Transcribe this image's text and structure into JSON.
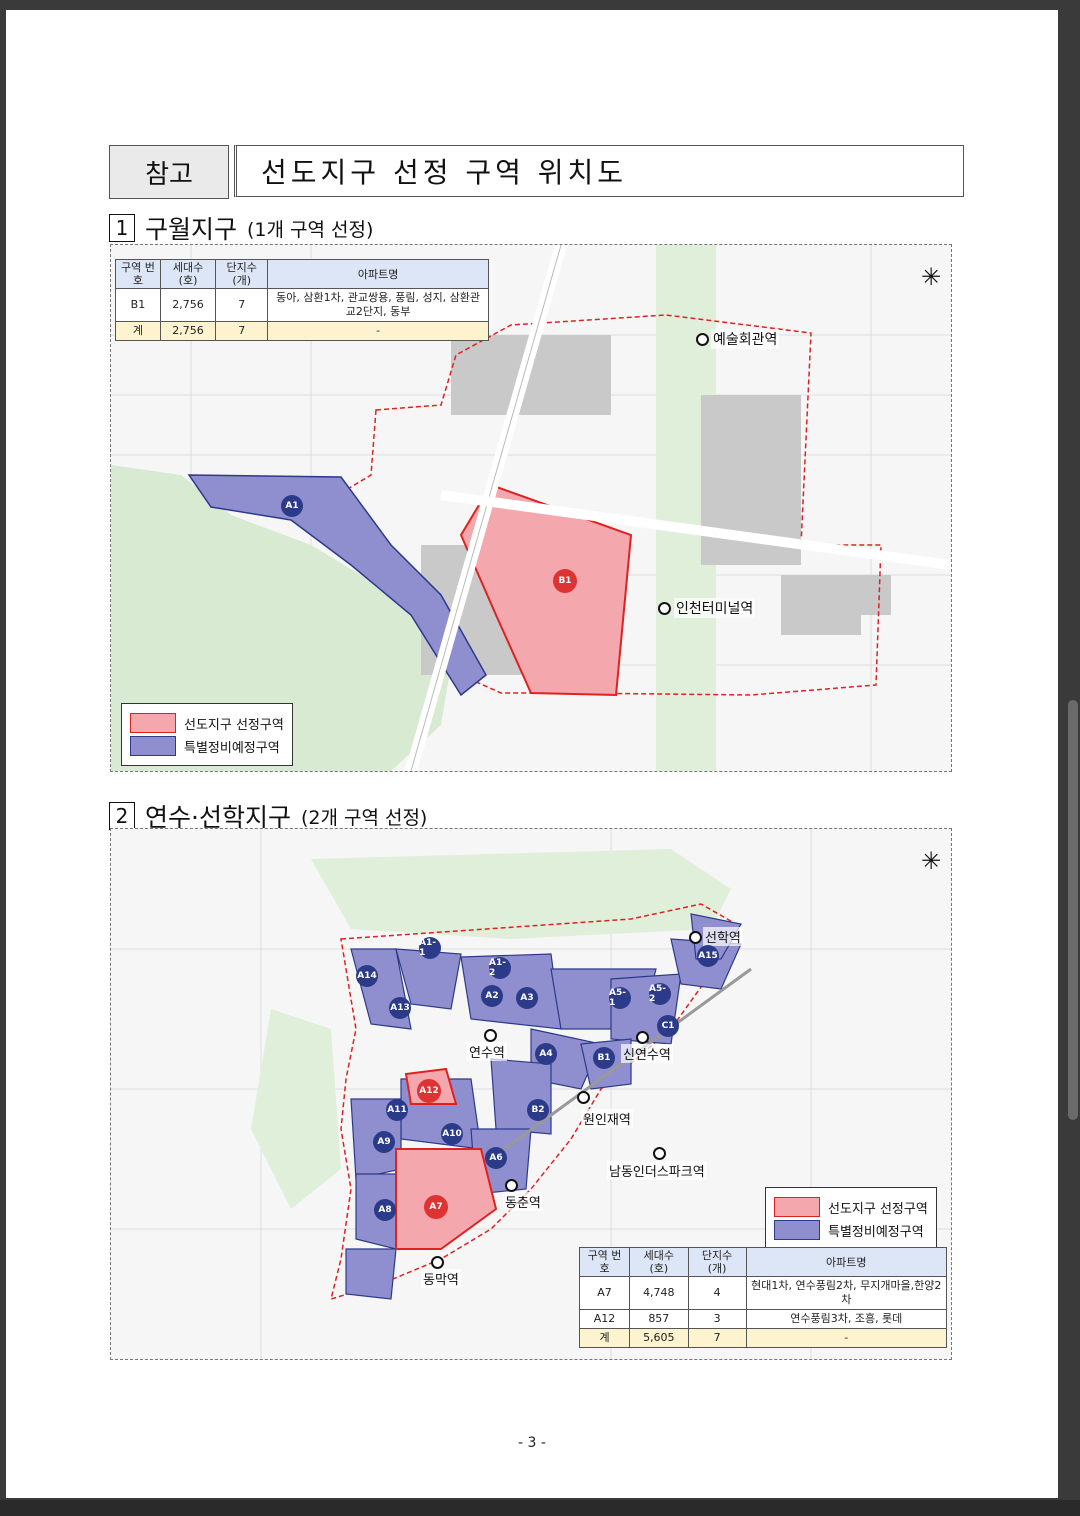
{
  "header": {
    "ref_label": "참고",
    "title": "선도지구 선정 구역 위치도"
  },
  "section1": {
    "num": "1",
    "title": "구월지구",
    "subtitle": "(1개 구역 선정)",
    "table": {
      "headers": [
        "구역 번호",
        "세대수 (호)",
        "단지수 (개)",
        "아파트명"
      ],
      "rows": [
        {
          "zone": "B1",
          "households": "2,756",
          "complexes": "7",
          "apartments": "동아, 삼환1차, 관교쌍용, 풍림, 성지, 삼환관교2단지, 동부"
        }
      ],
      "total": {
        "zone": "계",
        "households": "2,756",
        "complexes": "7",
        "apartments": "-"
      }
    },
    "stations": [
      "예술회관역",
      "인천터미널역"
    ],
    "zones": [
      "A1",
      "B1"
    ],
    "legend": {
      "selected": "선도지구 선정구역",
      "special": "특별정비예정구역"
    }
  },
  "section2": {
    "num": "2",
    "title": "연수·선학지구",
    "subtitle": "(2개 구역 선정)",
    "table": {
      "headers": [
        "구역 번호",
        "세대수 (호)",
        "단지수 (개)",
        "아파트명"
      ],
      "rows": [
        {
          "zone": "A7",
          "households": "4,748",
          "complexes": "4",
          "apartments": "현대1차, 연수풍림2차, 무지개마을,한양2차"
        },
        {
          "zone": "A12",
          "households": "857",
          "complexes": "3",
          "apartments": "연수풍림3차, 조흥, 롯데"
        }
      ],
      "total": {
        "zone": "계",
        "households": "5,605",
        "complexes": "7",
        "apartments": "-"
      }
    },
    "stations": [
      "선학역",
      "연수역",
      "신연수역",
      "원인재역",
      "남동인더스파크역",
      "동춘역",
      "동막역"
    ],
    "zones": [
      "A1-1",
      "A1-2",
      "A2",
      "A3",
      "A4",
      "A5-1",
      "A5-2",
      "A6",
      "A7",
      "A8",
      "A9",
      "A10",
      "A11",
      "A12",
      "A13",
      "A14",
      "A15",
      "B1",
      "B2",
      "C1"
    ],
    "legend": {
      "selected": "선도지구 선정구역",
      "special": "특별정비예정구역"
    }
  },
  "colors": {
    "selected_fill": "#f4a7ad",
    "selected_stroke": "#d22",
    "special_fill": "#8f8fd0",
    "special_stroke": "#2c3a8a"
  },
  "page_number": "- 3 -"
}
